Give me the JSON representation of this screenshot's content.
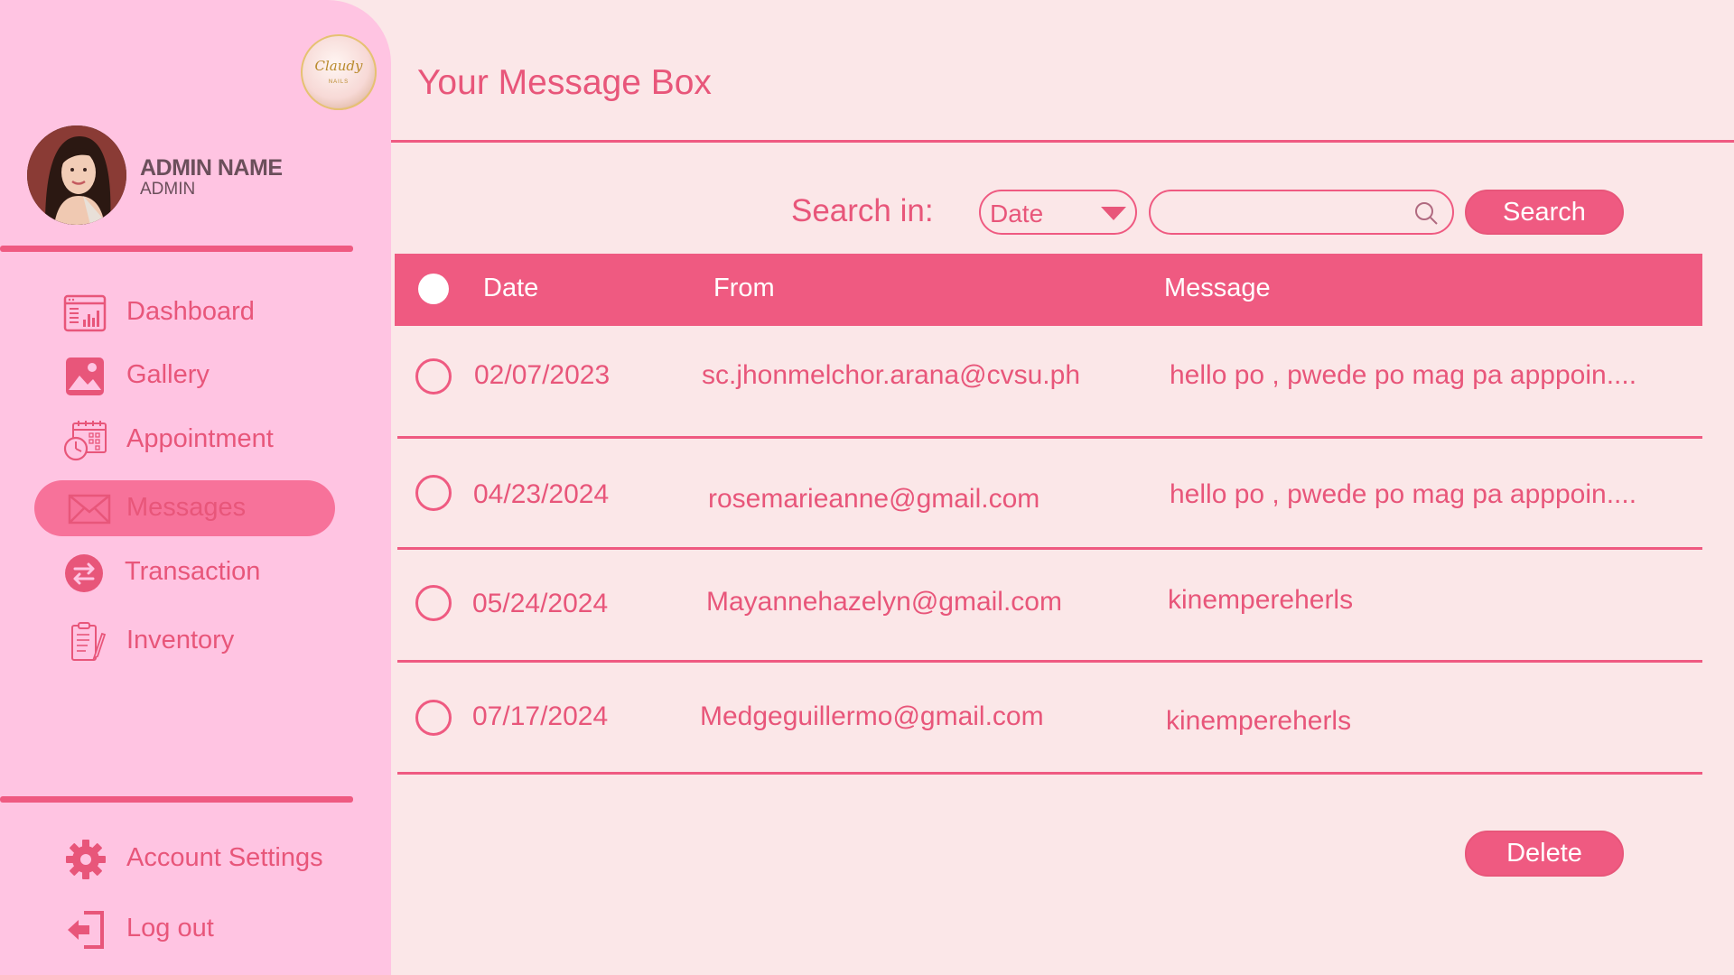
{
  "sidebar": {
    "logo": {
      "text": "Claudy",
      "sub": "NAILS"
    },
    "user": {
      "name": "ADMIN NAME",
      "role": "ADMIN"
    },
    "nav": [
      {
        "label": "Dashboard",
        "icon": "dashboard-icon"
      },
      {
        "label": "Gallery",
        "icon": "gallery-icon"
      },
      {
        "label": "Appointment",
        "icon": "calendar-clock-icon"
      },
      {
        "label": "Messages",
        "icon": "envelope-icon",
        "active": true
      },
      {
        "label": "Transaction",
        "icon": "transfer-arrows-icon"
      },
      {
        "label": "Inventory",
        "icon": "clipboard-icon"
      }
    ],
    "footer": [
      {
        "label": "Account Settings",
        "icon": "gear-icon"
      },
      {
        "label": "Log out",
        "icon": "logout-icon"
      }
    ]
  },
  "main": {
    "title": "Your Message Box",
    "search": {
      "label": "Search in:",
      "select_value": "Date",
      "input_value": "",
      "button": "Search"
    },
    "table": {
      "columns": [
        "Date",
        "From",
        "Message"
      ],
      "rows": [
        {
          "date": "02/07/2023",
          "from": "sc.jhonmelchor.arana@cvsu.ph",
          "message": "hello po , pwede po mag pa apppoin...."
        },
        {
          "date": "04/23/2024",
          "from": "rosemarieanne@gmail.com",
          "message": "hello po , pwede po mag pa apppoin...."
        },
        {
          "date": "05/24/2024",
          "from": "Mayannehazelyn@gmail.com",
          "message": "kinempereherls"
        },
        {
          "date": "07/17/2024",
          "from": "Medgeguillermo@gmail.com",
          "message": "kinempereherls"
        }
      ]
    },
    "delete_button": "Delete"
  },
  "colors": {
    "background": "#fbe7e8",
    "sidebar": "#ffc4e2",
    "accent": "#ef5a81",
    "text": "#e8567a",
    "admin_text": "#6b4f5b"
  }
}
